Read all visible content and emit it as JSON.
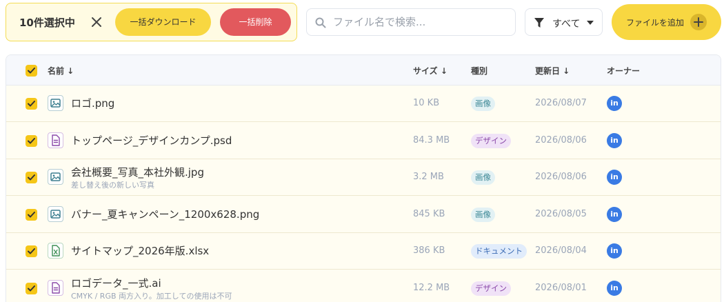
{
  "selection": {
    "count_label": "10件選択中",
    "download_label": "一括ダウンロード",
    "delete_label": "一括削除"
  },
  "search": {
    "placeholder": "ファイル名で検索..."
  },
  "filter": {
    "label": "すべて"
  },
  "add_button": {
    "label": "ファイルを追加"
  },
  "table": {
    "headers": {
      "name": "名前 ↓",
      "size": "サイズ ↓",
      "type": "種別",
      "updated": "更新日 ↓",
      "owner": "オーナー"
    },
    "rows": [
      {
        "name": "ロゴ.png",
        "note": "",
        "size": "10 KB",
        "type": "画像",
        "type_kind": "image",
        "updated": "2026/08/07",
        "owner": "in",
        "icon": "image-file-icon",
        "checked": true
      },
      {
        "name": "トップページ_デザインカンプ.psd",
        "note": "",
        "size": "84.3 MB",
        "type": "デザイン",
        "type_kind": "design",
        "updated": "2026/08/06",
        "owner": "in",
        "icon": "document-file-icon",
        "checked": true
      },
      {
        "name": "会社概要_写真_本社外観.jpg",
        "note": "差し替え後の新しい写真",
        "size": "3.2 MB",
        "type": "画像",
        "type_kind": "image",
        "updated": "2026/08/06",
        "owner": "in",
        "icon": "image-file-icon",
        "checked": true
      },
      {
        "name": "バナー_夏キャンペーン_1200x628.png",
        "note": "",
        "size": "845 KB",
        "type": "画像",
        "type_kind": "image",
        "updated": "2026/08/05",
        "owner": "in",
        "icon": "image-file-icon",
        "checked": true
      },
      {
        "name": "サイトマップ_2026年版.xlsx",
        "note": "",
        "size": "386 KB",
        "type": "ドキュメント",
        "type_kind": "document",
        "updated": "2026/08/04",
        "owner": "in",
        "icon": "spreadsheet-file-icon",
        "checked": true
      },
      {
        "name": "ロゴデータ_一式.ai",
        "note": "CMYK / RGB 両方入り。加工しての使用は不可",
        "size": "12.2 MB",
        "type": "デザイン",
        "type_kind": "design",
        "updated": "2026/08/01",
        "owner": "in",
        "icon": "document-file-icon",
        "checked": true
      }
    ]
  },
  "colors": {
    "accent_yellow": "#f8d741",
    "danger_red": "#e2595d",
    "checkbox": "#f5c618",
    "owner_blue": "#3a7be4",
    "badge_image_bg": "#e2f1f4",
    "badge_image_fg": "#3d8896",
    "badge_design_bg": "#f0e2f7",
    "badge_design_fg": "#8a48a8",
    "badge_document_bg": "#e1ecfb",
    "badge_document_fg": "#3d6db5"
  }
}
